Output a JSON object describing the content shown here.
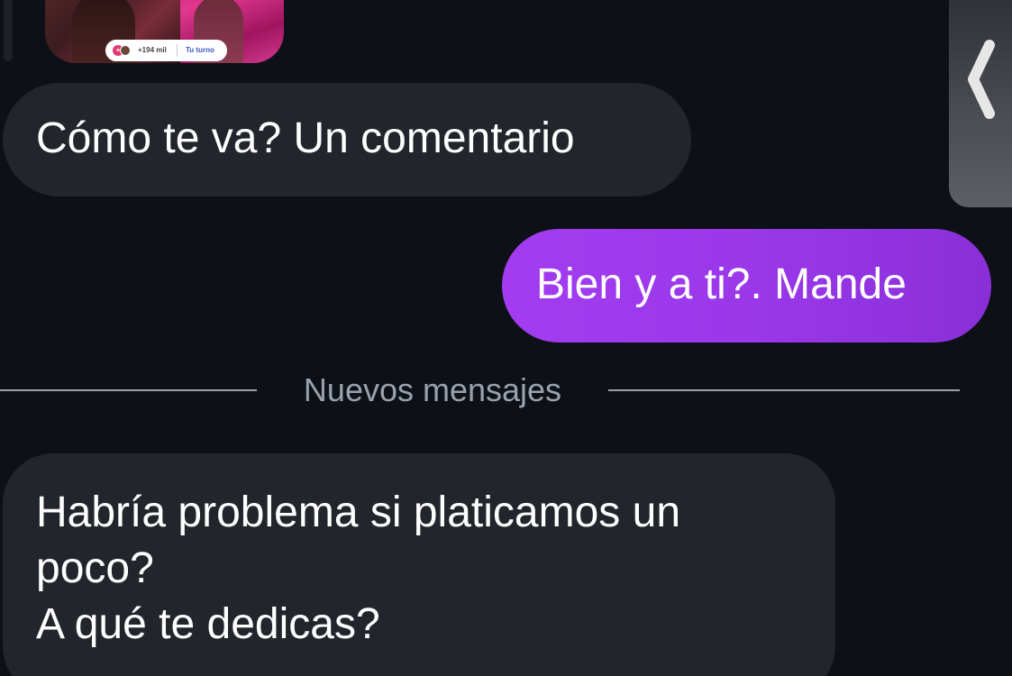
{
  "shared_card": {
    "viewer_count": "+194 mil",
    "turn_label": "Tu turno",
    "badge_icon": "reaction-icon"
  },
  "messages": [
    {
      "direction": "incoming",
      "text": "Cómo te va? Un comentario"
    },
    {
      "direction": "outgoing",
      "text": "Bien y a ti?. Mande"
    },
    {
      "direction": "incoming",
      "lines": [
        "Habría problema si platicamos un",
        "poco?",
        "A qué te dedicas?"
      ]
    }
  ],
  "divider": {
    "label": "Nuevos mensajes"
  },
  "colors": {
    "background": "#0d1117",
    "incoming_bubble": "#22262c",
    "outgoing_bubble": "#9a38ea",
    "divider": "#9aa1ab"
  },
  "edge_tab": {
    "icon": "chevron-left-icon"
  }
}
